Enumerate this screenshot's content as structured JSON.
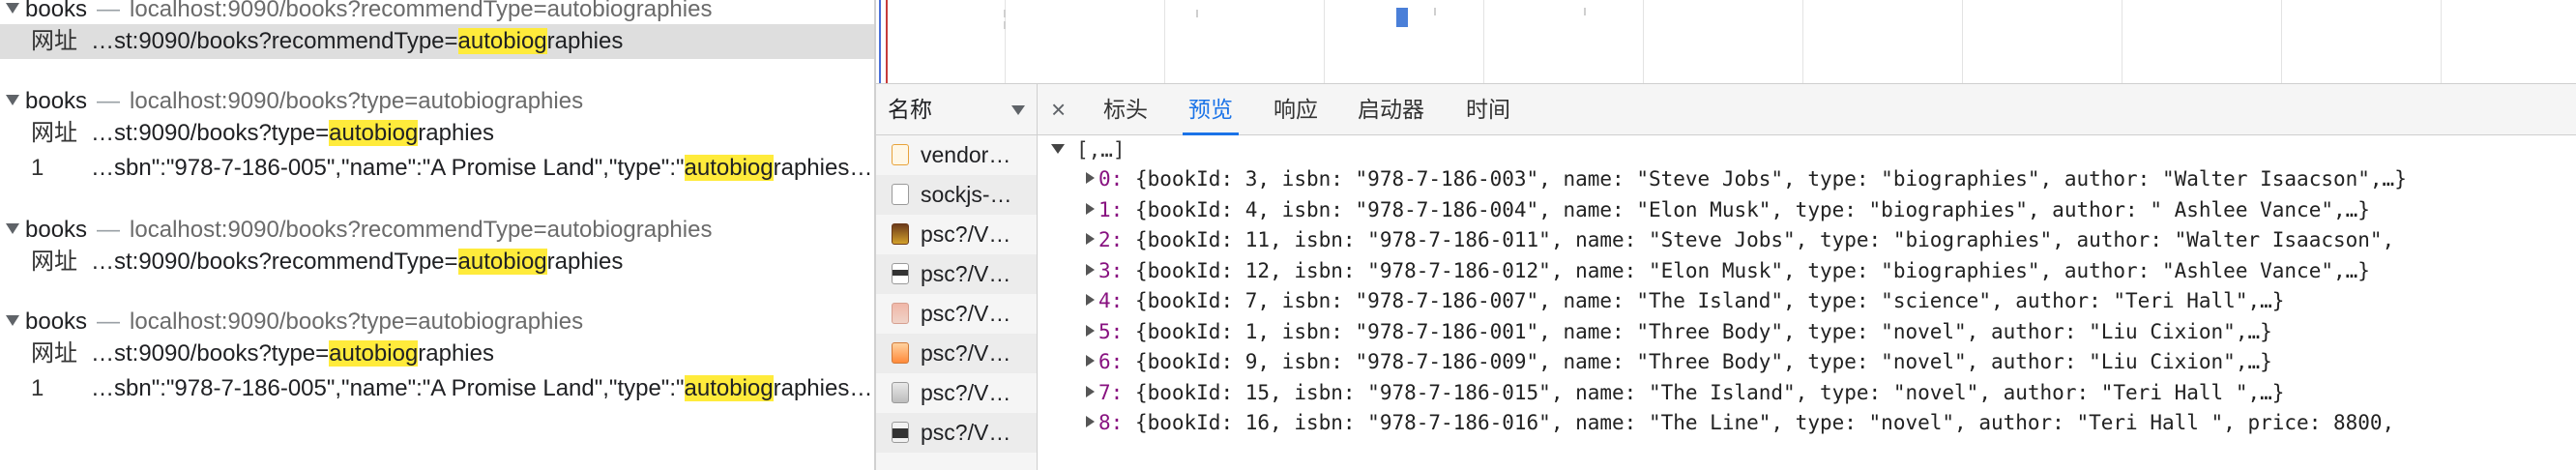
{
  "results": [
    {
      "name": "books",
      "url": "localhost:9090/books?recommendType=autobiographies",
      "rows": [
        {
          "label": "网址",
          "pre": "…st:9090/books?recommendType=",
          "hl": "autobiog",
          "post": "raphies",
          "selected": true
        }
      ]
    },
    {
      "name": "books",
      "url": "localhost:9090/books?type=autobiographies",
      "rows": [
        {
          "label": "网址",
          "pre": "…st:9090/books?type=",
          "hl": "autobiog",
          "post": "raphies",
          "selected": false
        },
        {
          "label": "1",
          "pre": "…sbn\":\"978-7-186-005\",\"name\":\"A Promise Land\",\"type\":\"",
          "hl": "autobiog",
          "post": "raphies…",
          "selected": false
        }
      ]
    },
    {
      "name": "books",
      "url": "localhost:9090/books?recommendType=autobiographies",
      "rows": [
        {
          "label": "网址",
          "pre": "…st:9090/books?recommendType=",
          "hl": "autobiog",
          "post": "raphies",
          "selected": false
        }
      ]
    },
    {
      "name": "books",
      "url": "localhost:9090/books?type=autobiographies",
      "rows": [
        {
          "label": "网址",
          "pre": "…st:9090/books?type=",
          "hl": "autobiog",
          "post": "raphies",
          "selected": false
        },
        {
          "label": "1",
          "pre": "…sbn\":\"978-7-186-005\",\"name\":\"A Promise Land\",\"type\":\"",
          "hl": "autobiog",
          "post": "raphies…",
          "selected": false
        }
      ]
    }
  ],
  "names_header": "名称",
  "requests": [
    {
      "name": "vendor…",
      "icon": "js"
    },
    {
      "name": "sockjs-…",
      "icon": "doc"
    },
    {
      "name": "psc?/V…",
      "icon": "img1"
    },
    {
      "name": "psc?/V…",
      "icon": "img2"
    },
    {
      "name": "psc?/V…",
      "icon": "img3"
    },
    {
      "name": "psc?/V…",
      "icon": "img4"
    },
    {
      "name": "psc?/V…",
      "icon": "img5"
    },
    {
      "name": "psc?/V…",
      "icon": "img6"
    }
  ],
  "tabs": {
    "close": "×",
    "headers": "标头",
    "preview": "预览",
    "response": "响应",
    "initiator": "启动器",
    "timing": "时间",
    "active": "preview"
  },
  "preview": {
    "root": "[,…]",
    "items": [
      {
        "index": "0:",
        "text": "{bookId: 3, isbn: \"978-7-186-003\", name: \"Steve Jobs\", type: \"biographies\", author: \"Walter Isaacson\",…}"
      },
      {
        "index": "1:",
        "text": "{bookId: 4, isbn: \"978-7-186-004\", name: \"Elon Musk\", type: \"biographies\", author: \" Ashlee Vance\",…}"
      },
      {
        "index": "2:",
        "text": "{bookId: 11, isbn: \"978-7-186-011\", name: \"Steve Jobs\", type: \"biographies\", author: \"Walter Isaacson\","
      },
      {
        "index": "3:",
        "text": "{bookId: 12, isbn: \"978-7-186-012\", name: \"Elon Musk\", type: \"biographies\", author: \"Ashlee Vance\",…}"
      },
      {
        "index": "4:",
        "text": "{bookId: 7, isbn: \"978-7-186-007\", name: \"The Island\", type: \"science\", author: \"Teri Hall\",…}"
      },
      {
        "index": "5:",
        "text": "{bookId: 1, isbn: \"978-7-186-001\", name: \"Three Body\", type: \"novel\", author: \"Liu Cixion\",…}"
      },
      {
        "index": "6:",
        "text": "{bookId: 9, isbn: \"978-7-186-009\", name: \"Three Body\", type: \"novel\", author: \"Liu Cixion\",…}"
      },
      {
        "index": "7:",
        "text": "{bookId: 15, isbn: \"978-7-186-015\", name: \"The Island\", type: \"novel\", author: \"Teri Hall \",…}"
      },
      {
        "index": "8:",
        "text": "{bookId: 16, isbn: \"978-7-186-016\", name: \"The Line\", type: \"novel\", author: \"Teri Hall \", price: 8800,"
      }
    ]
  },
  "colors": {
    "highlight": "#ffeb3b",
    "active_tab": "#1a73e8",
    "selected_row": "#dedede",
    "timeline_bar": "#4a7fd8"
  }
}
